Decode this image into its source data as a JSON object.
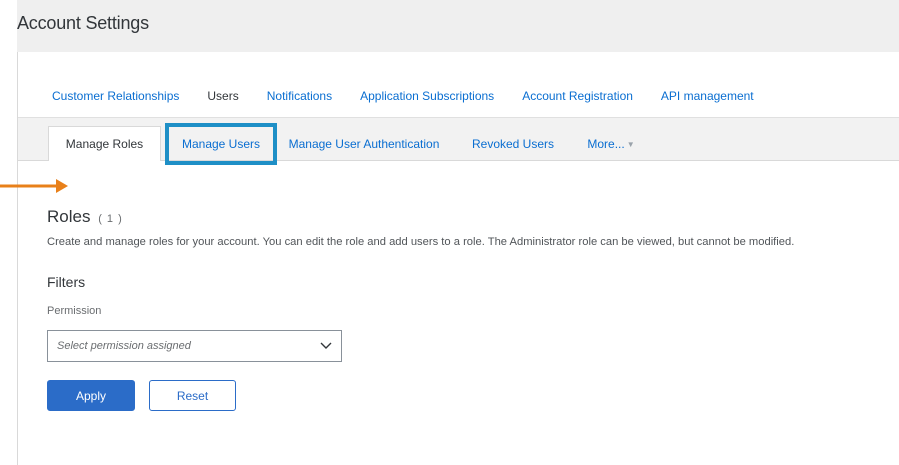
{
  "page": {
    "title": "Account Settings"
  },
  "top_tabs": [
    {
      "label": "Customer Relationships",
      "active": false
    },
    {
      "label": "Users",
      "active": true
    },
    {
      "label": "Notifications",
      "active": false
    },
    {
      "label": "Application Subscriptions",
      "active": false
    },
    {
      "label": "Account Registration",
      "active": false
    },
    {
      "label": "API management",
      "active": false
    }
  ],
  "sub_tabs": [
    {
      "label": "Manage Roles",
      "active": true
    },
    {
      "label": "Manage Users",
      "active": false,
      "highlighted": true
    },
    {
      "label": "Manage User Authentication",
      "active": false
    },
    {
      "label": "Revoked Users",
      "active": false
    },
    {
      "label": "More...",
      "active": false
    }
  ],
  "roles": {
    "heading": "Roles",
    "count": "( 1 )",
    "description": "Create and manage roles for your account. You can edit the role and add users to a role. The Administrator role can be viewed, but cannot be modified."
  },
  "filters": {
    "heading": "Filters",
    "permission_label": "Permission",
    "permission_placeholder": "Select permission assigned"
  },
  "buttons": {
    "apply": "Apply",
    "reset": "Reset"
  },
  "colors": {
    "link": "#0a6ed1",
    "primary_button": "#2b6cc8",
    "highlight_box": "#1e8fc6",
    "callout_arrow": "#e8801a"
  },
  "icons": {
    "select": "chevron-down-icon",
    "more": "caret-down-icon",
    "callout": "arrow-right-icon"
  }
}
